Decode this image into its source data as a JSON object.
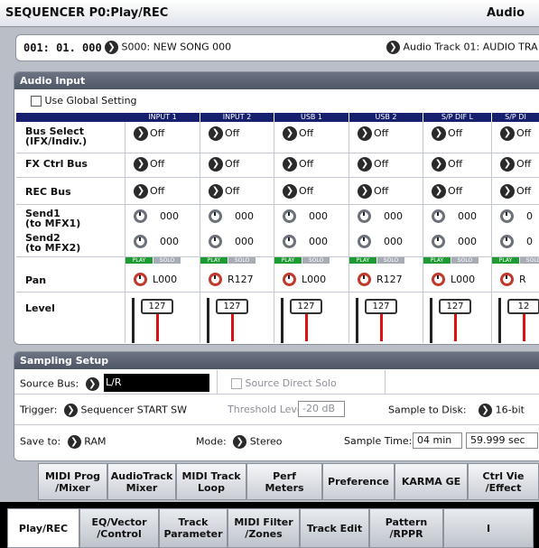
{
  "title": {
    "main": "SEQUENCER P0:Play/REC",
    "right": "Audio"
  },
  "song": {
    "position": "001: 01. 000",
    "popup_icon": "popup-arrow-icon",
    "song_label": "S000: NEW SONG 000",
    "track_label": "Audio Track 01: AUDIO TRA"
  },
  "audio_input": {
    "title": "Audio Input",
    "use_global": "Use Global Setting",
    "columns": [
      "INPUT 1",
      "INPUT 2",
      "USB 1",
      "USB 2",
      "S/P DIF L",
      "S/P DI"
    ],
    "rows": {
      "bus_select": {
        "label": "Bus Select\n(IFX/Indiv.)",
        "values": [
          "Off",
          "Off",
          "Off",
          "Off",
          "Off",
          "Off"
        ]
      },
      "fx_ctrl": {
        "label": "FX Ctrl Bus",
        "values": [
          "Off",
          "Off",
          "Off",
          "Off",
          "Off",
          "Off"
        ]
      },
      "rec_bus": {
        "label": "REC Bus",
        "values": [
          "Off",
          "Off",
          "Off",
          "Off",
          "Off",
          "Off"
        ]
      },
      "send1": {
        "label": "Send1\n(to MFX1)",
        "values": [
          "000",
          "000",
          "000",
          "000",
          "000",
          "0"
        ]
      },
      "send2": {
        "label": "Send2\n(to MFX2)",
        "values": [
          "000",
          "000",
          "000",
          "000",
          "000",
          "0"
        ]
      },
      "pan": {
        "label": "Pan",
        "values": [
          "L000",
          "R127",
          "L000",
          "R127",
          "L000",
          "R"
        ]
      },
      "level": {
        "label": "Level",
        "values": [
          "127",
          "127",
          "127",
          "127",
          "127",
          "12"
        ]
      }
    },
    "play": "PLAY",
    "solo": "SOLO"
  },
  "sampling": {
    "title": "Sampling Setup",
    "source_bus_label": "Source Bus:",
    "source_bus_value": "L/R",
    "source_direct_solo": "Source Direct Solo",
    "trigger_label": "Trigger:",
    "trigger_value": "Sequencer START SW",
    "threshold_label": "Threshold Level:",
    "threshold_value": "-20 dB",
    "sample_to_disk_label": "Sample to Disk:",
    "sample_to_disk_value": "16-bit",
    "save_to_label": "Save to:",
    "save_to_value": "RAM",
    "mode_label": "Mode:",
    "mode_value": "Stereo",
    "sample_time_label": "Sample Time:",
    "sample_time_min": "04 min",
    "sample_time_sec": "59.999 sec"
  },
  "upper_tabs": [
    "MIDI Prog\n/Mixer",
    "AudioTrack\nMixer",
    "MIDI Track\nLoop",
    "Perf\nMeters",
    "Preference",
    "KARMA GE",
    "Ctrl Vie\n/Effect"
  ],
  "lower_tabs": [
    "Play/REC",
    "EQ/Vector\n/Control",
    "Track\nParameter",
    "MIDI Filter\n/Zones",
    "Track Edit",
    "Pattern\n/RPPR",
    "I"
  ]
}
